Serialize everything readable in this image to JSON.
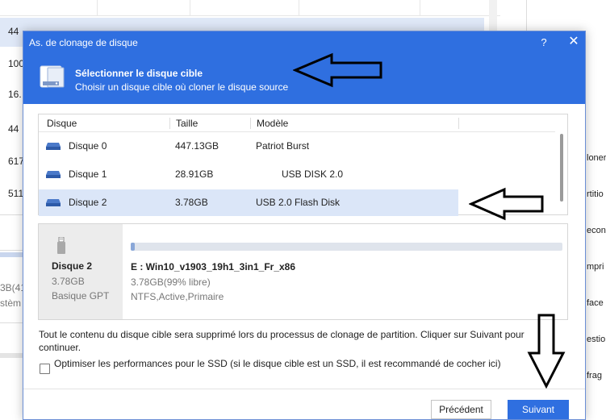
{
  "background": {
    "rows": [
      "44",
      "100",
      "16.",
      "44",
      "617",
      "511"
    ],
    "left_texts": [
      "3B(41%",
      "stèm"
    ],
    "right_items": [
      "loner",
      "rtitio",
      "econ",
      "mpri",
      "face",
      "estio",
      "frag"
    ]
  },
  "dialog": {
    "title": "As. de clonage de disque",
    "help": "?",
    "close": "✕",
    "step_title": "Sélectionner le disque cible",
    "step_subtitle": "Choisir un disque cible où cloner le disque source"
  },
  "table": {
    "columns": [
      "Disque",
      "Taille",
      "Modèle"
    ],
    "rows": [
      {
        "disk": "Disque 0",
        "size": "447.13GB",
        "model": "Patriot Burst"
      },
      {
        "disk": "Disque 1",
        "size": "28.91GB",
        "model": "USB DISK 2.0"
      },
      {
        "disk": "Disque 2",
        "size": "3.78GB",
        "model": "USB 2.0 Flash Disk"
      }
    ],
    "selected_index": 2
  },
  "detail": {
    "name": "Disque 2",
    "size": "3.78GB",
    "type": "Basique GPT",
    "usage_fraction": 0.01,
    "partition_label": "E : Win10_v1903_19h1_3in1_Fr_x86",
    "partition_free": "3.78GB(99% libre)",
    "partition_fs": "NTFS,Active,Primaire"
  },
  "warning": "Tout le contenu du disque cible sera supprimé lors du processus de clonage de partition. Cliquer sur Suivant pour continuer.",
  "ssd_option": {
    "label": "Optimiser les performances pour le SSD (si le disque cible est un SSD, il est recommandé de cocher ici)",
    "checked": false
  },
  "buttons": {
    "previous": "Précédent",
    "next": "Suivant"
  },
  "colors": {
    "header": "#2f6fe0",
    "selected_row": "#dbe6f8",
    "primary_button": "#2f6fe0"
  }
}
